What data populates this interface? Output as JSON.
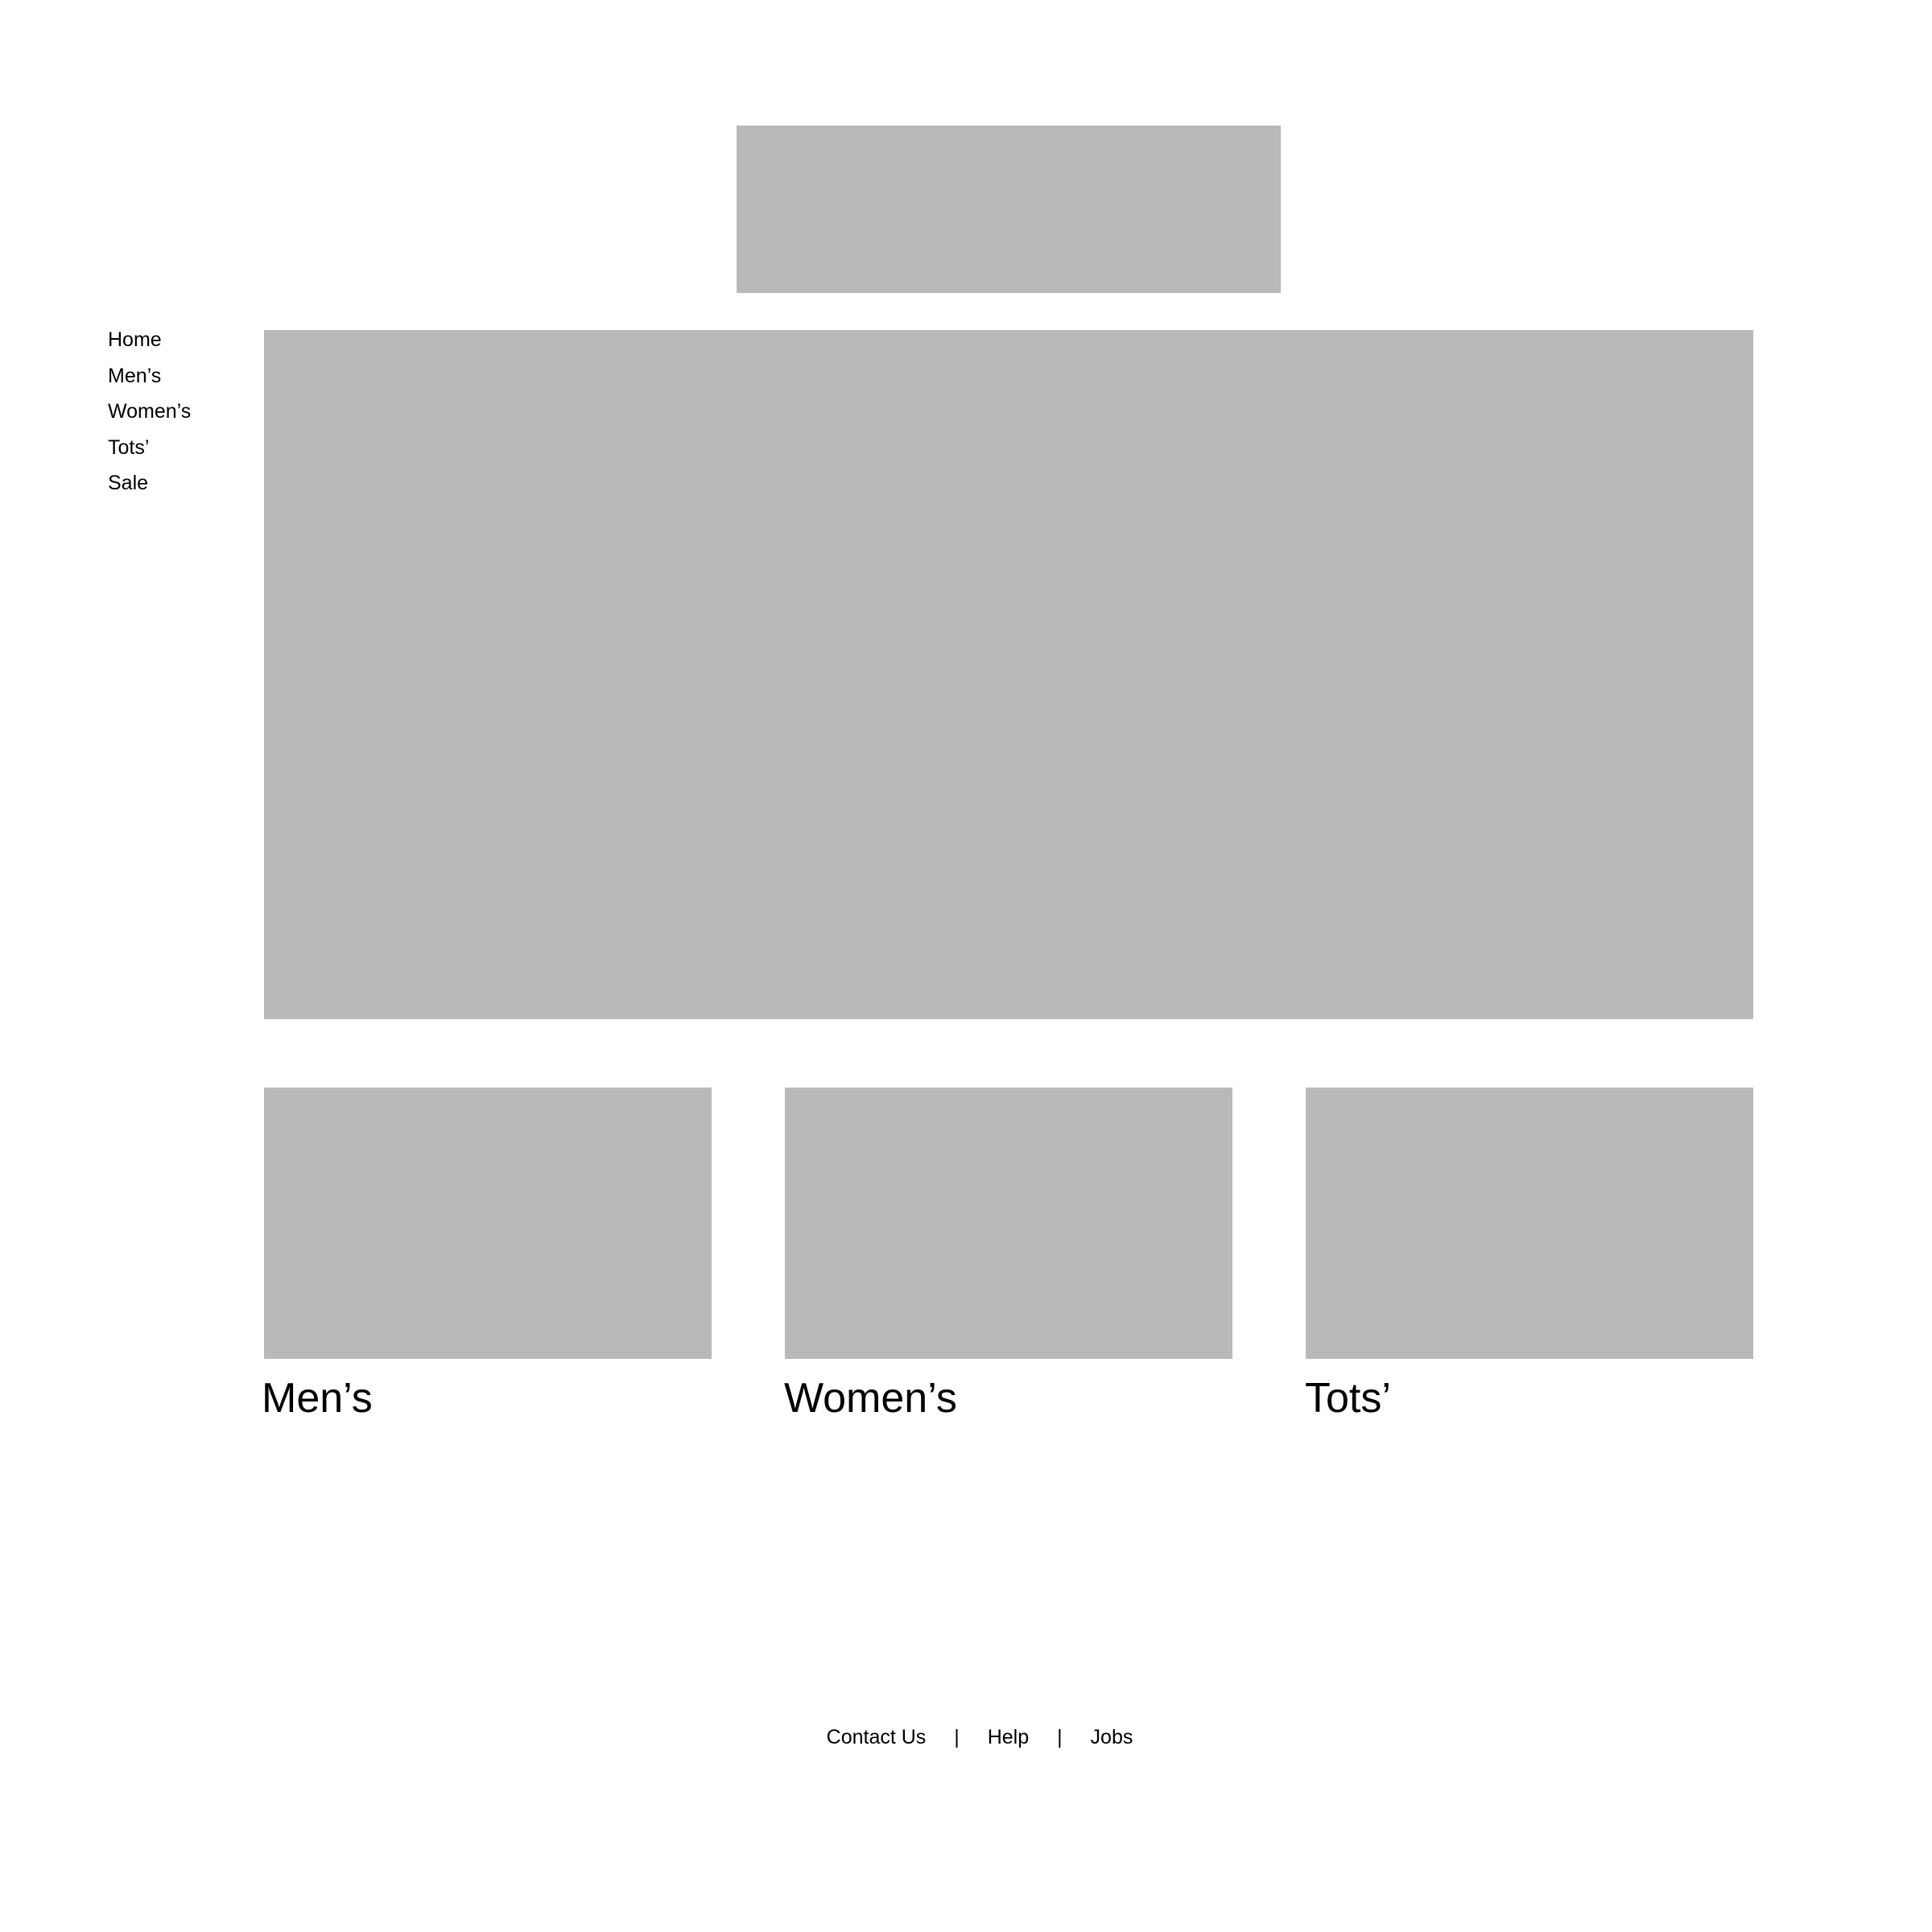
{
  "nav": {
    "items": [
      {
        "label": "Home"
      },
      {
        "label": "Men’s"
      },
      {
        "label": "Women’s"
      },
      {
        "label": "Tots’"
      },
      {
        "label": "Sale"
      }
    ]
  },
  "categories": {
    "mens": {
      "title": "Men’s"
    },
    "womens": {
      "title": "Women’s"
    },
    "tots": {
      "title": "Tots’"
    }
  },
  "footer": {
    "links": [
      {
        "label": "Contact Us"
      },
      {
        "label": "Help"
      },
      {
        "label": "Jobs"
      }
    ],
    "separator": "|"
  },
  "colors": {
    "placeholder": "#b9b9b9",
    "background": "#ffffff",
    "text": "#000000"
  }
}
